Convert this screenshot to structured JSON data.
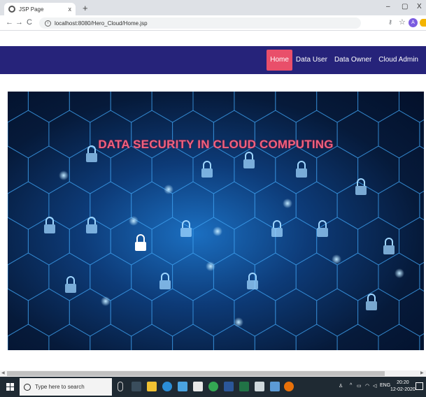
{
  "browser": {
    "tab_title": "JSP Page",
    "tab_close": "x",
    "new_tab": "+",
    "minimize": "–",
    "maximize": "▢",
    "close": "X",
    "url": "localhost:8080/Hero_Cloud/Home.jsp",
    "back": "←",
    "forward": "→",
    "reload": "C",
    "profile_initial": "A"
  },
  "nav": {
    "items": [
      {
        "label": "Home",
        "active": true
      },
      {
        "label": "Data User",
        "active": false
      },
      {
        "label": "Data Owner",
        "active": false
      },
      {
        "label": "Cloud Admin",
        "active": false
      }
    ]
  },
  "hero": {
    "title": "DATA SECURITY IN CLOUD COMPUTING"
  },
  "taskbar": {
    "search_placeholder": "Type here to search",
    "language": "ENG",
    "time": "20:20",
    "date": "12-02-2020"
  },
  "colors": {
    "nav_bg": "#26237a",
    "active_nav": "#e94f6a",
    "hero_title": "#f0607e"
  }
}
